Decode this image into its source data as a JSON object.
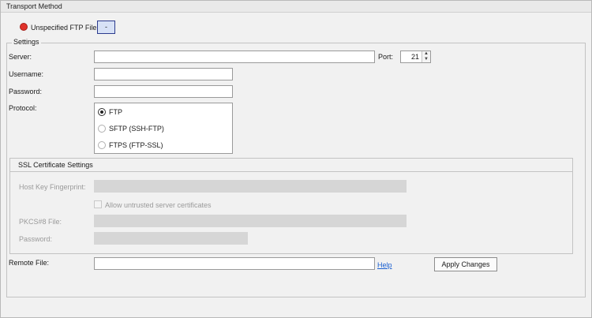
{
  "panel": {
    "title": "Transport Method"
  },
  "status": {
    "text": "Unspecified FTP File",
    "dot_color": "#e0322a",
    "button_label": "-"
  },
  "settings": {
    "legend": "Settings",
    "server_label": "Server:",
    "server_value": "",
    "port_label": "Port:",
    "port_value": "21",
    "username_label": "Username:",
    "username_value": "",
    "password_label": "Password:",
    "password_value": "",
    "protocol_label": "Protocol:",
    "protocols": [
      {
        "label": "FTP",
        "selected": true
      },
      {
        "label": "SFTP (SSH-FTP)",
        "selected": false
      },
      {
        "label": "FTPS (FTP-SSL)",
        "selected": false
      }
    ]
  },
  "ssl": {
    "title": "SSL Certificate Settings",
    "host_key_label": "Host Key Fingerprint:",
    "host_key_value": "",
    "allow_untrusted_label": "Allow untrusted server certificates",
    "allow_untrusted_checked": false,
    "pkcs_label": "PKCS#8 File:",
    "pkcs_value": "",
    "password_label": "Password:",
    "password_value": ""
  },
  "remote": {
    "label": "Remote File:",
    "value": "",
    "help_label": "Help",
    "apply_label": "Apply Changes"
  }
}
